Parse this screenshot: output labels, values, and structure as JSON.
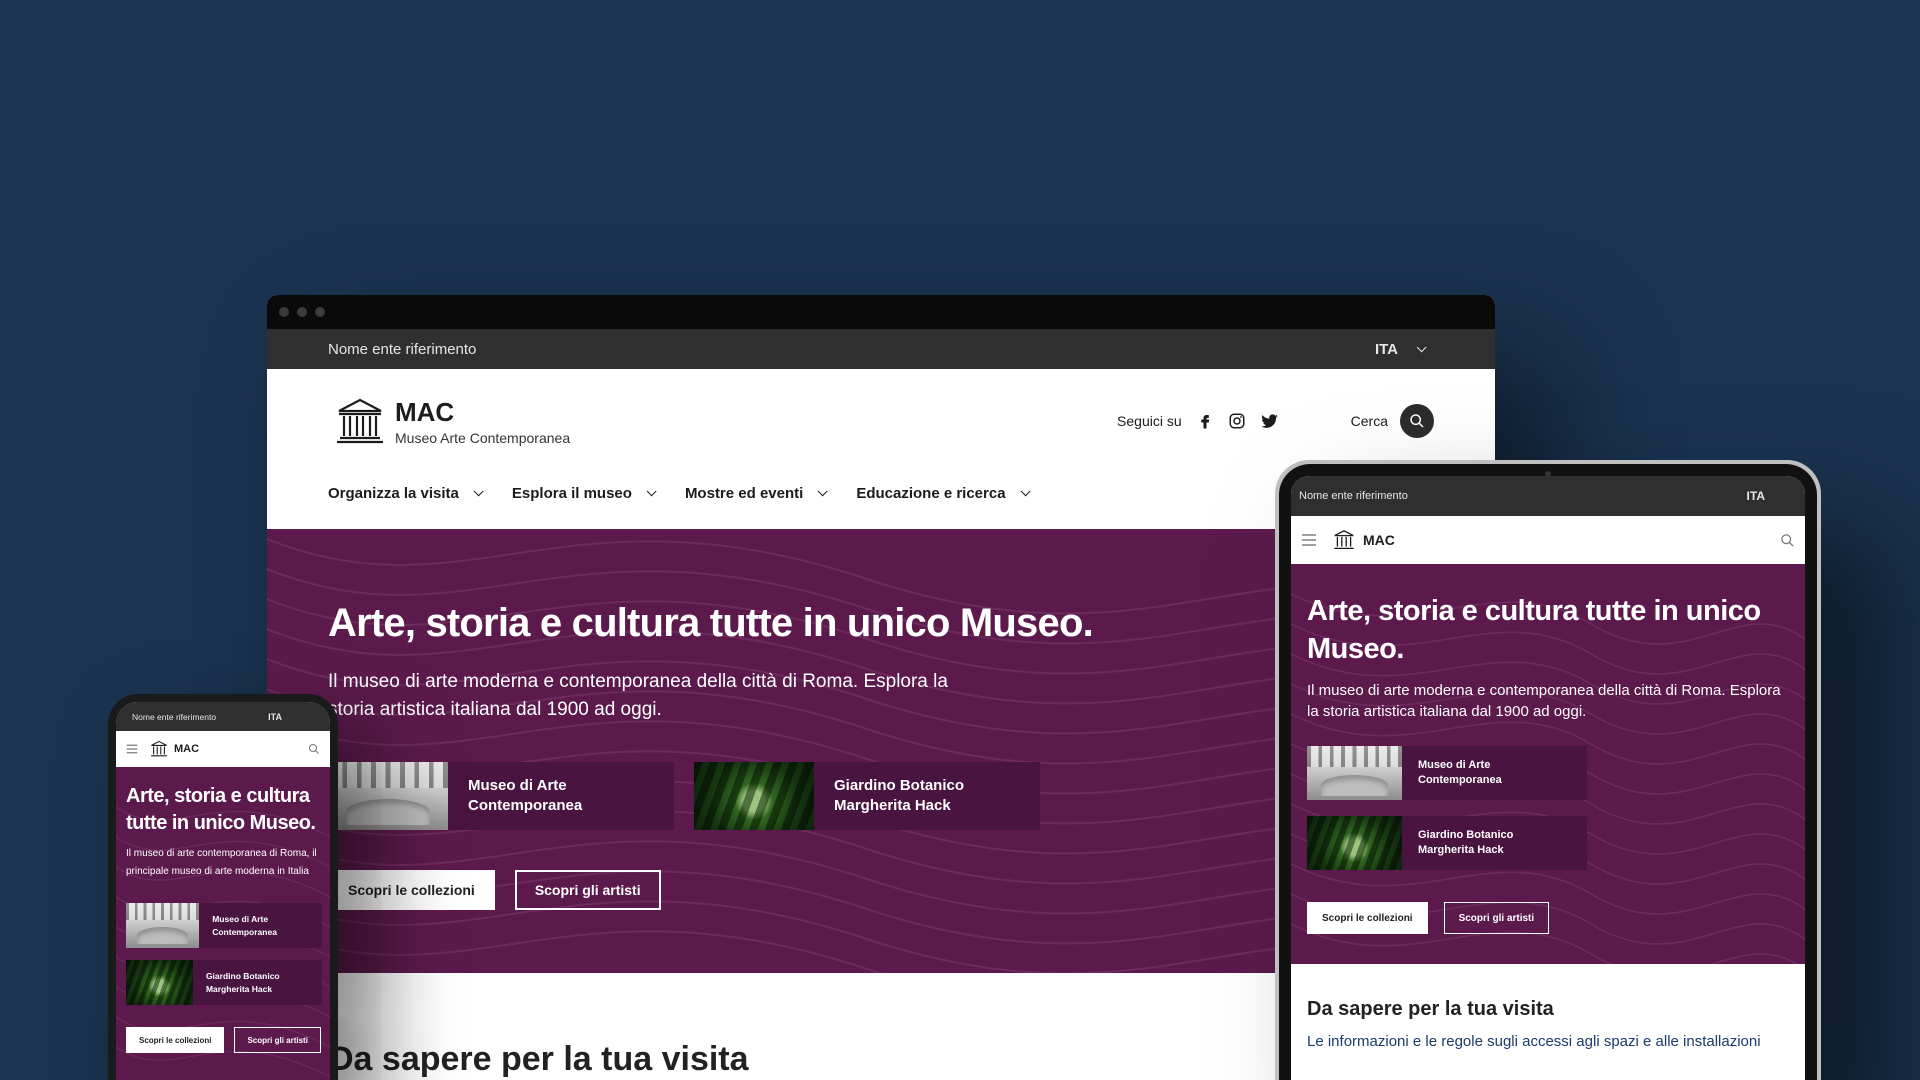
{
  "colors": {
    "background": "#1a3350",
    "hero_purple": "#5c1a4c",
    "card_purple": "#4a1440",
    "slim_header": "#2f2f2f"
  },
  "desktop": {
    "slim_header": {
      "entity": "Nome ente riferimento",
      "language": "ITA"
    },
    "header": {
      "title": "MAC",
      "subtitle": "Museo Arte Contemporanea",
      "follow_label": "Seguici su",
      "social_icons": [
        "facebook-icon",
        "instagram-icon",
        "twitter-icon"
      ],
      "search_label": "Cerca"
    },
    "nav": [
      {
        "label": "Organizza la visita"
      },
      {
        "label": "Esplora il museo"
      },
      {
        "label": "Mostre ed eventi"
      },
      {
        "label": "Educazione e ricerca"
      }
    ],
    "hero": {
      "title": "Arte, storia e cultura tutte in unico Museo.",
      "description": "Il museo di arte moderna e contemporanea della città di Roma. Esplora la storia artistica italiana dal 1900 ad oggi.",
      "cards": [
        {
          "label": "Museo di Arte Contemporanea"
        },
        {
          "label": "Giardino Botanico Margherita Hack"
        }
      ],
      "buttons": {
        "primary": "Scopri le collezioni",
        "secondary": "Scopri gli artisti"
      }
    },
    "section_title": "Da sapere per la tua visita"
  },
  "tablet": {
    "slim_header": {
      "entity": "Nome ente riferimento",
      "language": "ITA"
    },
    "header": {
      "title": "MAC"
    },
    "hero": {
      "title": "Arte, storia e cultura tutte in unico Museo.",
      "description": "Il museo di arte moderna e contemporanea della città di Roma. Esplora la storia artistica italiana dal 1900 ad oggi.",
      "cards": [
        {
          "label": "Museo di Arte Contemporanea"
        },
        {
          "label": "Giardino Botanico Margherita Hack"
        }
      ],
      "buttons": {
        "primary": "Scopri le collezioni",
        "secondary": "Scopri gli artisti"
      }
    },
    "section": {
      "title": "Da sapere per la tua visita",
      "text": "Le informazioni e le regole sugli accessi agli spazi e alle installazioni"
    }
  },
  "phone": {
    "slim_header": {
      "entity": "Nome ente riferimento",
      "language": "ITA"
    },
    "header": {
      "title": "MAC"
    },
    "hero": {
      "title": "Arte, storia e cultura tutte in unico Museo.",
      "description": "Il museo di arte contemporanea di Roma, il principale museo di arte moderna in Italia",
      "cards": [
        {
          "label": "Museo di Arte Contemporanea"
        },
        {
          "label": "Giardino Botanico Margherita Hack"
        }
      ],
      "buttons": {
        "primary": "Scopri le collezioni",
        "secondary": "Scopri gli artisti"
      }
    }
  }
}
